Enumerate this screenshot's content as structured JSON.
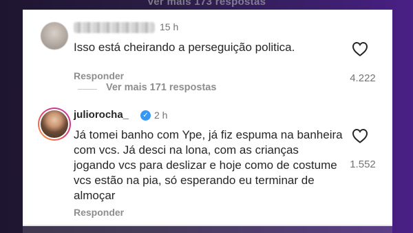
{
  "background_top_text": "Ver mais 173 respostas",
  "comments": [
    {
      "username_blurred": true,
      "time": "15 h",
      "text": "Isso está cheirando a perseguição politica.",
      "reply_label": "Responder",
      "likes": "4.222",
      "heart_icon": "heart-outline-icon"
    },
    {
      "username": "juliorocha_",
      "verified": true,
      "time": "2 h",
      "text": "Já tomei banho com Ype, já fiz espuma na banheira com vcs. Já desci na lona, com as crianças jogando vcs para deslizar e hoje como de costume vcs estão na pia, só esperando eu terminar de almoçar",
      "reply_label": "Responder",
      "likes": "1.552",
      "heart_icon": "heart-outline-icon"
    }
  ],
  "view_more_replies": "Ver mais 171 respostas",
  "colors": {
    "background": "#2a1d45",
    "verified": "#3897f0",
    "text": "#262626",
    "muted": "#8e8e8e"
  }
}
